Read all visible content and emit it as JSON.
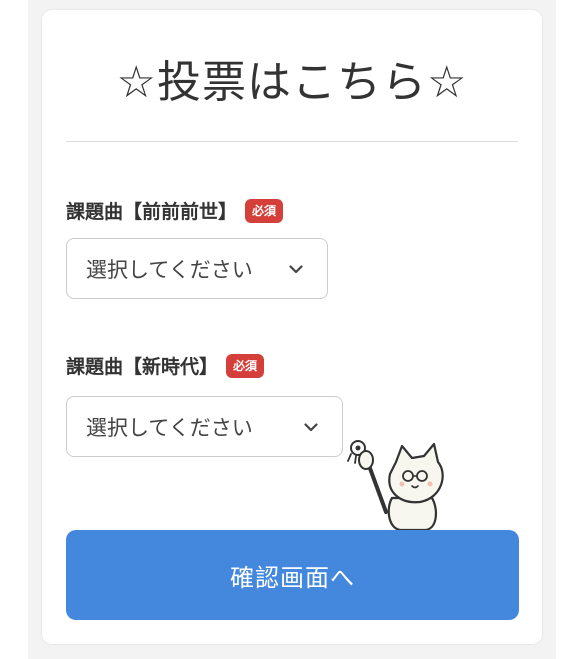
{
  "form": {
    "title": "☆投票はこちら☆",
    "fields": [
      {
        "label": "課題曲【前前前世】",
        "required_badge": "必須",
        "selected": "選択してください"
      },
      {
        "label": "課題曲【新時代】",
        "required_badge": "必須",
        "selected": "選択してください"
      }
    ],
    "submit_label": "確認画面へ"
  },
  "colors": {
    "accent": "#4488dd",
    "required": "#d43f3a",
    "background": "#f3f3f3"
  },
  "icons": [
    "chevron-down-icon",
    "cat-mascot-illustration"
  ]
}
